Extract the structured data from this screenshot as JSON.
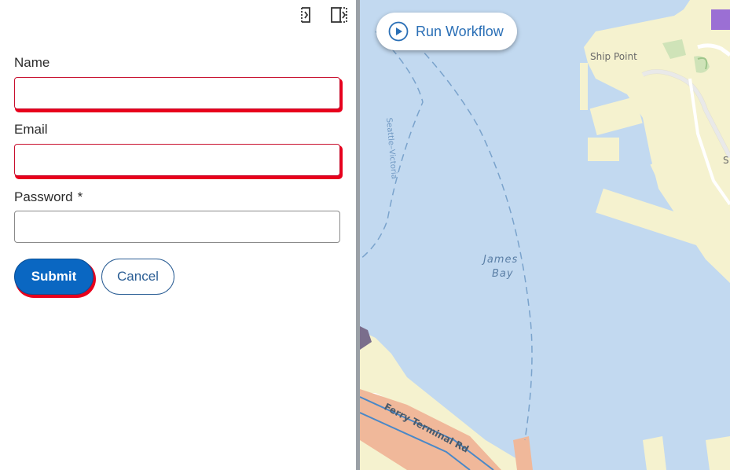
{
  "form": {
    "fields": [
      {
        "label": "Name",
        "required": false,
        "value": "",
        "invalid": true
      },
      {
        "label": "Email",
        "required": false,
        "value": "",
        "invalid": true
      },
      {
        "label": "Password",
        "required": true,
        "required_mark": "*",
        "value": "",
        "invalid": false
      }
    ],
    "submit_label": "Submit",
    "cancel_label": "Cancel"
  },
  "map": {
    "run_button_label": "Run Workflow",
    "labels": {
      "ship_point": "Ship Point",
      "ferry_route": "Seattle–Victoria",
      "james": "James",
      "bay": "Bay",
      "ferry_terminal": "Ferry Terminal Rd",
      "edge_s": "S"
    }
  },
  "colors": {
    "primary": "#0a67c2",
    "error": "#e8001c",
    "water": "#c2d9f0",
    "land": "#f5f2cf",
    "road": "#f0b89a"
  }
}
